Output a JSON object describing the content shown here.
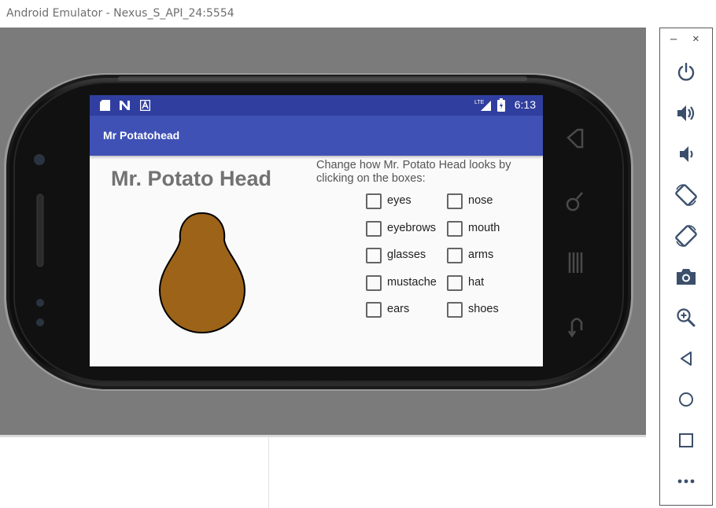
{
  "window": {
    "title": "Android Emulator - Nexus_S_API_24:5554"
  },
  "status_bar": {
    "time": "6:13",
    "network_label": "LTE"
  },
  "app_bar": {
    "title": "Mr Potatohead"
  },
  "main": {
    "heading": "Mr. Potato Head",
    "instructions": "Change how Mr. Potato Head looks by clicking on the boxes:",
    "checkboxes": [
      {
        "label": "eyes",
        "checked": false
      },
      {
        "label": "nose",
        "checked": false
      },
      {
        "label": "eyebrows",
        "checked": false
      },
      {
        "label": "mouth",
        "checked": false
      },
      {
        "label": "glasses",
        "checked": false
      },
      {
        "label": "arms",
        "checked": false
      },
      {
        "label": "mustache",
        "checked": false
      },
      {
        "label": "hat",
        "checked": false
      },
      {
        "label": "ears",
        "checked": false
      },
      {
        "label": "shoes",
        "checked": false
      }
    ],
    "potato_color": "#9c6319"
  },
  "colors": {
    "status_bar": "#303f9f",
    "app_bar": "#3f51b5",
    "emulator_background": "#7b7b7b",
    "heading_text": "#727272"
  },
  "toolbar": {
    "minimize_label": "–",
    "close_label": "×",
    "items": [
      {
        "icon": "power-icon",
        "label": "Power"
      },
      {
        "icon": "volume-up-icon",
        "label": "Volume up"
      },
      {
        "icon": "volume-down-icon",
        "label": "Volume down"
      },
      {
        "icon": "rotate-left-icon",
        "label": "Rotate left"
      },
      {
        "icon": "rotate-right-icon",
        "label": "Rotate right"
      },
      {
        "icon": "camera-icon",
        "label": "Take screenshot"
      },
      {
        "icon": "zoom-icon",
        "label": "Zoom"
      },
      {
        "icon": "back-icon",
        "label": "Back"
      },
      {
        "icon": "home-icon",
        "label": "Home"
      },
      {
        "icon": "overview-icon",
        "label": "Overview"
      },
      {
        "icon": "more-icon",
        "label": "Extended controls"
      }
    ]
  }
}
